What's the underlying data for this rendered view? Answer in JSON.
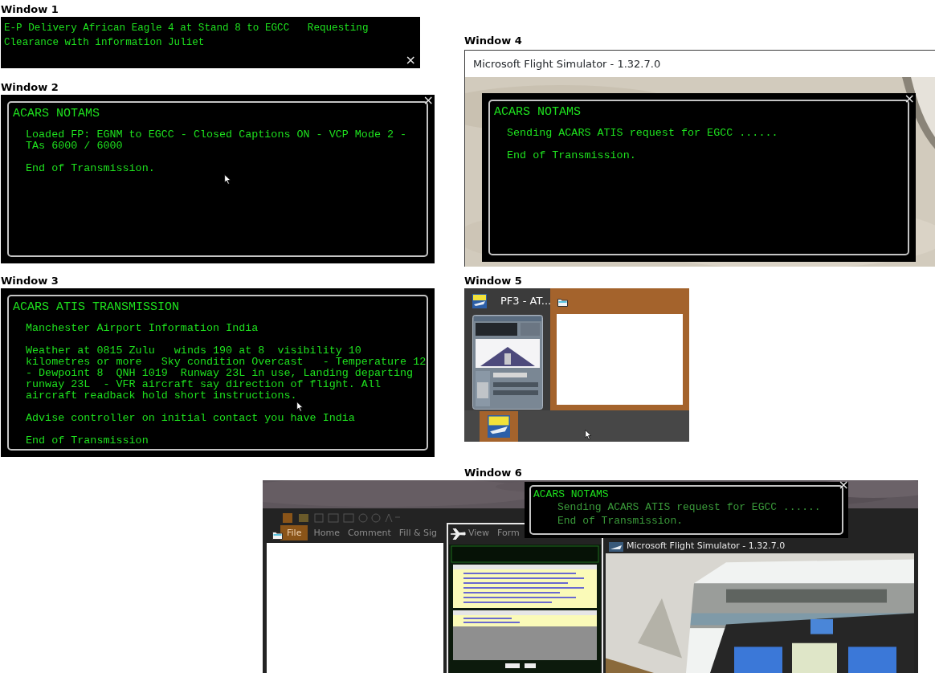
{
  "windows": [
    {
      "kind": "banner",
      "label": "Window 1",
      "text": "E-P Delivery African Eagle 4 at Stand 8 to EGCC   Requesting Clearance with information Juliet",
      "close": "×"
    },
    {
      "kind": "terminal",
      "label": "Window 2",
      "title": "ACARS NOTAMS",
      "paragraphs": [
        "Loaded FP: EGNM to EGCC - Closed Captions ON - VCP Mode 2 - TAs 6000 / 6000",
        "End of Transmission."
      ],
      "close": "×"
    },
    {
      "kind": "terminal",
      "label": "Window 3",
      "title": "ACARS ATIS TRANSMISSION",
      "paragraphs": [
        "Manchester Airport Information India",
        "Weather at 0815 Zulu   winds 190 at 8  visibility 10 kilometres or more   Sky condition Overcast   - Temperature 12   - Dewpoint 8  QNH 1019  Runway 23L in use, Landing departing runway 23L  - VFR aircraft say direction of flight. All aircraft readback hold short instructions.",
        "Advise controller on initial contact you have India",
        "End of Transmission"
      ]
    },
    {
      "kind": "app",
      "label": "Window 4",
      "title": "Microsoft Flight Simulator - 1.32.7.0",
      "terminal": {
        "title": "ACARS NOTAMS",
        "paragraphs": [
          "Sending ACARS ATIS request for EGCC ......",
          "End of Transmission."
        ],
        "close": "×"
      }
    },
    {
      "kind": "switcher",
      "label": "Window 5",
      "thumbnails": [
        {
          "kind": "window",
          "title": "PF3 - AT...",
          "selected": false
        },
        {
          "kind": "blank",
          "selected": true
        }
      ],
      "taskbar": [
        {
          "active": true
        }
      ]
    },
    {
      "kind": "taskview",
      "label": "Window 6",
      "terminal": {
        "title": "ACARS NOTAMS",
        "paragraphs": [
          "Sending ACARS ATIS request for EGCC ......",
          "End of Transmission."
        ],
        "close": "×"
      },
      "ribbon": [
        {
          "label": "File",
          "selected": true
        },
        {
          "label": "Home",
          "selected": false
        },
        {
          "label": "Comment",
          "selected": false
        },
        {
          "label": "Fill & Sig",
          "selected": false
        },
        {
          "label": "View",
          "selected": false
        },
        {
          "label": "Form",
          "selected": false
        }
      ],
      "thumbnails": [
        {
          "kind": "blank",
          "selected": false
        },
        {
          "kind": "window",
          "selected": true
        },
        {
          "title": "Microsoft Flight Simulator - 1.32.7.0",
          "selected": false
        }
      ]
    }
  ]
}
